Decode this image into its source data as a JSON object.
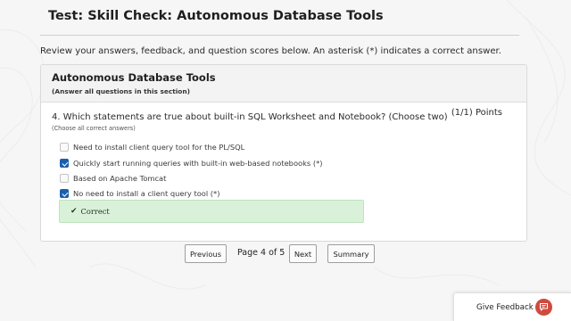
{
  "page": {
    "title": "Test: Skill Check: Autonomous Database Tools",
    "instructions": "Review your answers, feedback, and question scores below. An asterisk (*) indicates a correct answer."
  },
  "section": {
    "title": "Autonomous Database Tools",
    "subtitle": "(Answer all questions in this section)"
  },
  "question": {
    "text": "4. Which statements are true about built-in SQL Worksheet and Notebook? (Choose two)",
    "points": "(1/1) Points",
    "hint": "(Choose all correct answers)",
    "options": [
      {
        "label": "Need to install client query tool for the PL/SQL",
        "checked": false
      },
      {
        "label": "Quickly start running queries with built-in web-based notebooks (*)",
        "checked": true
      },
      {
        "label": "Based on Apache Tomcat",
        "checked": false
      },
      {
        "label": "No need to install a client query tool (*)",
        "checked": true
      }
    ],
    "feedback": "Correct"
  },
  "navigation": {
    "previous_label": "Previous",
    "page_indicator": "Page 4 of 5",
    "next_label": "Next",
    "summary_label": "Summary"
  },
  "feedback_widget": {
    "label": "Give Feedback",
    "icon": "speech-bubble-icon"
  },
  "colors": {
    "checkbox_checked": "#1a5fad",
    "feedback_bg": "#daf1d9",
    "feedback_widget_icon": "#cf4a3e"
  }
}
